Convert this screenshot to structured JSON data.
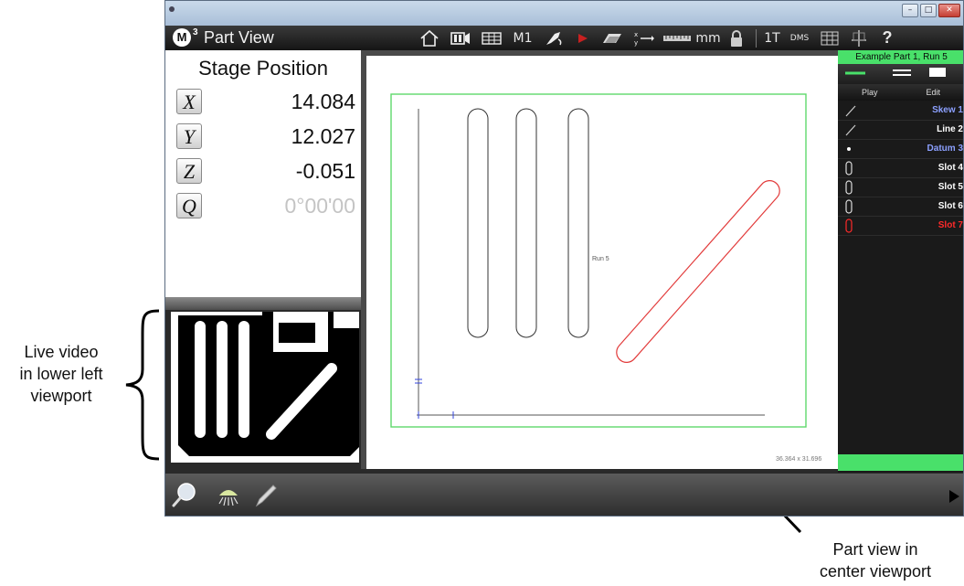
{
  "annotations": {
    "live_video": [
      "Live video",
      "in lower left",
      "viewport"
    ],
    "part_view": [
      "Part view in",
      "center viewport"
    ]
  },
  "window": {
    "title_bar_icon": "app-window-icon",
    "controls": [
      "minimize",
      "maximize",
      "close"
    ]
  },
  "toolbar": {
    "logo_text": "M",
    "logo_superscript": "3",
    "title": "Part View",
    "items": [
      {
        "name": "home-icon"
      },
      {
        "name": "video-icon"
      },
      {
        "name": "table-icon"
      },
      {
        "name": "m1-label",
        "label": "M1"
      },
      {
        "name": "probe-icon"
      },
      {
        "name": "run-icon"
      },
      {
        "name": "plane-icon"
      },
      {
        "name": "axis-swap-icon"
      },
      {
        "name": "ruler-icon"
      },
      {
        "name": "units-label",
        "label": "mm"
      },
      {
        "name": "lock-icon"
      },
      {
        "name": "tolerance-label",
        "label": "1T"
      },
      {
        "name": "angle-format-label",
        "label": "DMS"
      },
      {
        "name": "grid-icon"
      },
      {
        "name": "datum-icon"
      },
      {
        "name": "help-icon",
        "label": "?"
      }
    ]
  },
  "stage": {
    "title": "Stage Position",
    "axes": [
      {
        "label": "X",
        "value": "14.084",
        "dim": false
      },
      {
        "label": "Y",
        "value": "12.027",
        "dim": false
      },
      {
        "label": "Z",
        "value": "-0.051",
        "dim": false
      },
      {
        "label": "Q",
        "value": "0°00'00",
        "dim": true
      }
    ]
  },
  "part_view": {
    "run_label": "Run 5",
    "size_label": "36.364 x 31.696"
  },
  "feature_panel": {
    "title": "Example Part 1, Run 5",
    "tabs": [
      "Play",
      "Edit"
    ],
    "features": [
      {
        "name": "Skew 1",
        "icon": "line-icon",
        "color": "#8ca0ff"
      },
      {
        "name": "Line 2",
        "icon": "line-icon",
        "color": "#ffffff"
      },
      {
        "name": "Datum 3",
        "icon": "point-icon",
        "color": "#8ca0ff"
      },
      {
        "name": "Slot 4",
        "icon": "slot-icon",
        "color": "#ffffff"
      },
      {
        "name": "Slot 5",
        "icon": "slot-icon",
        "color": "#ffffff"
      },
      {
        "name": "Slot 6",
        "icon": "slot-icon",
        "color": "#ffffff"
      },
      {
        "name": "Slot 7",
        "icon": "slot-icon",
        "color": "#ff2a2a"
      }
    ]
  },
  "bottom_bar": {
    "tools": [
      "zoom-icon",
      "light-icon",
      "pen-icon"
    ],
    "play": "play-icon"
  },
  "colors": {
    "accent_green": "#49e06a",
    "measured_red": "#e23b3b"
  }
}
